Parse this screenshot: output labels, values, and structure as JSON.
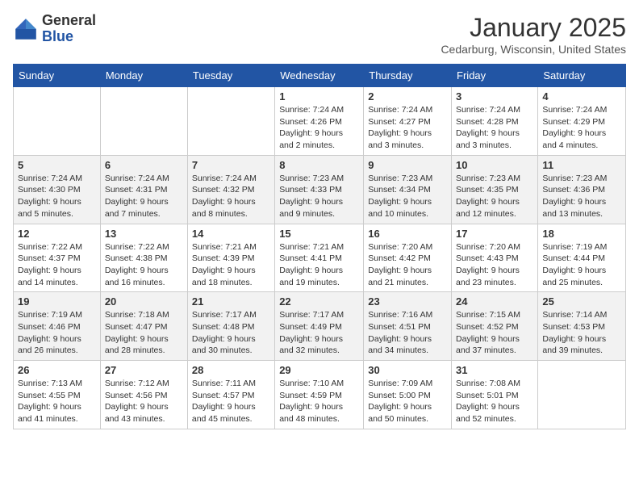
{
  "logo": {
    "general": "General",
    "blue": "Blue"
  },
  "title": "January 2025",
  "location": "Cedarburg, Wisconsin, United States",
  "weekdays": [
    "Sunday",
    "Monday",
    "Tuesday",
    "Wednesday",
    "Thursday",
    "Friday",
    "Saturday"
  ],
  "weeks": [
    [
      {
        "day": "",
        "content": ""
      },
      {
        "day": "",
        "content": ""
      },
      {
        "day": "",
        "content": ""
      },
      {
        "day": "1",
        "content": "Sunrise: 7:24 AM\nSunset: 4:26 PM\nDaylight: 9 hours and 2 minutes."
      },
      {
        "day": "2",
        "content": "Sunrise: 7:24 AM\nSunset: 4:27 PM\nDaylight: 9 hours and 3 minutes."
      },
      {
        "day": "3",
        "content": "Sunrise: 7:24 AM\nSunset: 4:28 PM\nDaylight: 9 hours and 3 minutes."
      },
      {
        "day": "4",
        "content": "Sunrise: 7:24 AM\nSunset: 4:29 PM\nDaylight: 9 hours and 4 minutes."
      }
    ],
    [
      {
        "day": "5",
        "content": "Sunrise: 7:24 AM\nSunset: 4:30 PM\nDaylight: 9 hours and 5 minutes."
      },
      {
        "day": "6",
        "content": "Sunrise: 7:24 AM\nSunset: 4:31 PM\nDaylight: 9 hours and 7 minutes."
      },
      {
        "day": "7",
        "content": "Sunrise: 7:24 AM\nSunset: 4:32 PM\nDaylight: 9 hours and 8 minutes."
      },
      {
        "day": "8",
        "content": "Sunrise: 7:23 AM\nSunset: 4:33 PM\nDaylight: 9 hours and 9 minutes."
      },
      {
        "day": "9",
        "content": "Sunrise: 7:23 AM\nSunset: 4:34 PM\nDaylight: 9 hours and 10 minutes."
      },
      {
        "day": "10",
        "content": "Sunrise: 7:23 AM\nSunset: 4:35 PM\nDaylight: 9 hours and 12 minutes."
      },
      {
        "day": "11",
        "content": "Sunrise: 7:23 AM\nSunset: 4:36 PM\nDaylight: 9 hours and 13 minutes."
      }
    ],
    [
      {
        "day": "12",
        "content": "Sunrise: 7:22 AM\nSunset: 4:37 PM\nDaylight: 9 hours and 14 minutes."
      },
      {
        "day": "13",
        "content": "Sunrise: 7:22 AM\nSunset: 4:38 PM\nDaylight: 9 hours and 16 minutes."
      },
      {
        "day": "14",
        "content": "Sunrise: 7:21 AM\nSunset: 4:39 PM\nDaylight: 9 hours and 18 minutes."
      },
      {
        "day": "15",
        "content": "Sunrise: 7:21 AM\nSunset: 4:41 PM\nDaylight: 9 hours and 19 minutes."
      },
      {
        "day": "16",
        "content": "Sunrise: 7:20 AM\nSunset: 4:42 PM\nDaylight: 9 hours and 21 minutes."
      },
      {
        "day": "17",
        "content": "Sunrise: 7:20 AM\nSunset: 4:43 PM\nDaylight: 9 hours and 23 minutes."
      },
      {
        "day": "18",
        "content": "Sunrise: 7:19 AM\nSunset: 4:44 PM\nDaylight: 9 hours and 25 minutes."
      }
    ],
    [
      {
        "day": "19",
        "content": "Sunrise: 7:19 AM\nSunset: 4:46 PM\nDaylight: 9 hours and 26 minutes."
      },
      {
        "day": "20",
        "content": "Sunrise: 7:18 AM\nSunset: 4:47 PM\nDaylight: 9 hours and 28 minutes."
      },
      {
        "day": "21",
        "content": "Sunrise: 7:17 AM\nSunset: 4:48 PM\nDaylight: 9 hours and 30 minutes."
      },
      {
        "day": "22",
        "content": "Sunrise: 7:17 AM\nSunset: 4:49 PM\nDaylight: 9 hours and 32 minutes."
      },
      {
        "day": "23",
        "content": "Sunrise: 7:16 AM\nSunset: 4:51 PM\nDaylight: 9 hours and 34 minutes."
      },
      {
        "day": "24",
        "content": "Sunrise: 7:15 AM\nSunset: 4:52 PM\nDaylight: 9 hours and 37 minutes."
      },
      {
        "day": "25",
        "content": "Sunrise: 7:14 AM\nSunset: 4:53 PM\nDaylight: 9 hours and 39 minutes."
      }
    ],
    [
      {
        "day": "26",
        "content": "Sunrise: 7:13 AM\nSunset: 4:55 PM\nDaylight: 9 hours and 41 minutes."
      },
      {
        "day": "27",
        "content": "Sunrise: 7:12 AM\nSunset: 4:56 PM\nDaylight: 9 hours and 43 minutes."
      },
      {
        "day": "28",
        "content": "Sunrise: 7:11 AM\nSunset: 4:57 PM\nDaylight: 9 hours and 45 minutes."
      },
      {
        "day": "29",
        "content": "Sunrise: 7:10 AM\nSunset: 4:59 PM\nDaylight: 9 hours and 48 minutes."
      },
      {
        "day": "30",
        "content": "Sunrise: 7:09 AM\nSunset: 5:00 PM\nDaylight: 9 hours and 50 minutes."
      },
      {
        "day": "31",
        "content": "Sunrise: 7:08 AM\nSunset: 5:01 PM\nDaylight: 9 hours and 52 minutes."
      },
      {
        "day": "",
        "content": ""
      }
    ]
  ]
}
